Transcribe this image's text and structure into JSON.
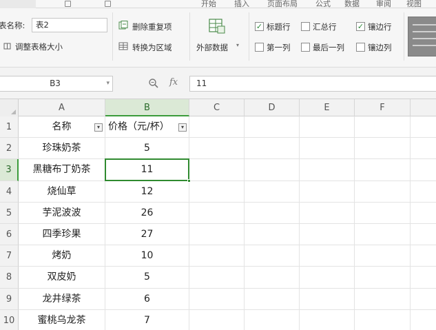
{
  "menubar": {
    "start_label": "开始",
    "insert_label": "插入",
    "layout_label": "页面布局",
    "formulas_label": "公式",
    "data_label": "数据",
    "review_label": "审阅",
    "view_label": "视图"
  },
  "ribbon": {
    "table_name_label": "表名称:",
    "table_name_value": "表2",
    "resize_table_label": "调整表格大小",
    "remove_duplicates_label": "删除重复项",
    "convert_to_range_label": "转换为区域",
    "external_data_label": "外部数据",
    "header_row_label": "标题行",
    "total_row_label": "汇总行",
    "banded_rows_label": "镶边行",
    "first_column_label": "第一列",
    "last_column_label": "最后一列",
    "banded_columns_label": "镶边列",
    "header_row_checked": true,
    "total_row_checked": false,
    "banded_rows_checked": true,
    "first_column_checked": false,
    "last_column_checked": false,
    "banded_columns_checked": false
  },
  "formula_bar": {
    "cell_ref": "B3",
    "fx_label": "fx",
    "value": "11"
  },
  "columns": [
    "A",
    "B",
    "C",
    "D",
    "E",
    "F"
  ],
  "rows": [
    "1",
    "2",
    "3",
    "4",
    "5",
    "6",
    "7",
    "8",
    "9",
    "10"
  ],
  "table": {
    "header_a": "名称",
    "header_b": "价格（元/杯）",
    "names": [
      "珍珠奶茶",
      "黑糖布丁奶茶",
      "烧仙草",
      "芋泥波波",
      "四季珍果",
      "烤奶",
      "双皮奶",
      "龙井绿茶",
      "蜜桃乌龙茶"
    ],
    "prices": [
      "5",
      "11",
      "12",
      "26",
      "27",
      "10",
      "5",
      "6",
      "7"
    ]
  },
  "selection": {
    "cell": "B3",
    "color": "#2f8a2f"
  }
}
